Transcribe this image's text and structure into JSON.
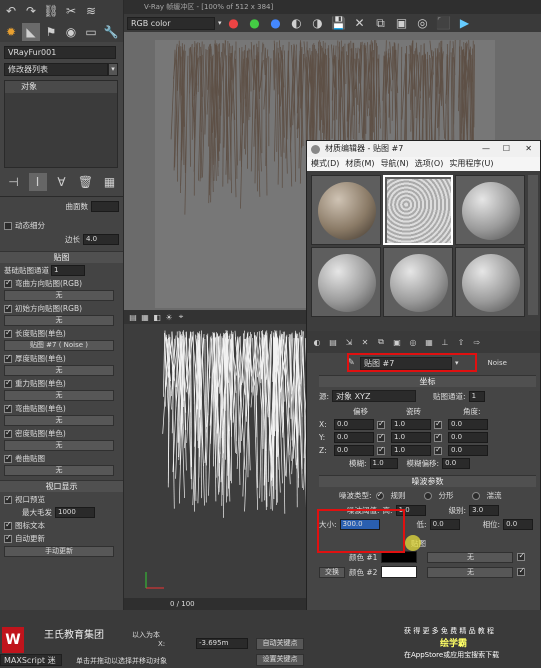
{
  "window": {
    "title": "V-Ray 帧缓冲区 - [100% of 512 x 384]",
    "channel": "RGB color"
  },
  "left_panel": {
    "object_name": "VRayFur001",
    "modifier_list": "修改器列表",
    "stack_item": "对象",
    "bend_count_label": "曲面数",
    "dynamic_subdiv_label": "动态细分",
    "tess_label": "边长",
    "tess_value": "4.0",
    "maps_header": "贴图",
    "base_map_channel_label": "基础贴图通道",
    "base_map_channel_value": "1",
    "map_rows": [
      {
        "label": "弯曲方向贴图(RGB)",
        "value": "无"
      },
      {
        "label": "初始方向贴图(RGB)",
        "value": "无"
      },
      {
        "label": "长度贴图(单色)",
        "value": "贴图 #7 ( Noise )"
      },
      {
        "label": "厚度贴图(单色)",
        "value": "无"
      },
      {
        "label": "重力贴图(单色)",
        "value": "无"
      },
      {
        "label": "弯曲贴图(单色)",
        "value": "无"
      },
      {
        "label": "密度贴图(单色)",
        "value": "无"
      },
      {
        "label": "卷曲贴图",
        "value": "无"
      }
    ],
    "viewport_header": "视口显示",
    "viewport_preview": "视口预览",
    "max_hairs_label": "最大毛发",
    "max_hairs_value": "1000",
    "icon_text": "图标文本",
    "auto_update": "自动更新",
    "manual_update": "手动更新"
  },
  "timeline": {
    "frame": "0 / 100"
  },
  "material_editor": {
    "title": "材质编辑器 - 贴图 #7",
    "menu": [
      "模式(D)",
      "材质(M)",
      "导航(N)",
      "选项(O)",
      "实用程序(U)"
    ],
    "map_name": "贴图 #7",
    "map_type": "Noise",
    "coords_header": "坐标",
    "source_label": "源:",
    "source_value": "对象 XYZ",
    "map_channel_label": "贴图通道:",
    "map_channel_value": "1",
    "offset_label": "偏移",
    "tiling_label": "瓷砖",
    "angle_label": "角度:",
    "axes": [
      "X:",
      "Y:",
      "Z:"
    ],
    "offset_values": [
      "0.0",
      "0.0",
      "0.0"
    ],
    "tiling_values": [
      "1.0",
      "1.0",
      "1.0"
    ],
    "angle_values": [
      "0.0",
      "0.0",
      "0.0"
    ],
    "blur_label": "模糊:",
    "blur_value": "1.0",
    "blur_offset_label": "模糊偏移:",
    "blur_offset_value": "0.0",
    "noise_header": "噪波参数",
    "noise_type_label": "噪波类型:",
    "noise_types": [
      "规则",
      "分形",
      "湍流"
    ],
    "threshold_label": "噪波阈值:",
    "high_label": "高:",
    "high_value": "1.0",
    "levels_label": "级别:",
    "levels_value": "3.0",
    "size_label": "大小:",
    "size_value": "300.0",
    "low_label": "低:",
    "low_value": "0.0",
    "phase_label": "相位:",
    "phase_value": "0.0",
    "swap_label": "交换",
    "color1_label": "颜色 #1",
    "color2_label": "颜色 #2",
    "maps_label": "贴图",
    "none_label": "无"
  },
  "status_bar": {
    "maxscript": "MAXScript 迷",
    "x_label": "X:",
    "z_value": "-3.695m",
    "auto_key": "自动关键点",
    "set_key": "设置关键点",
    "hint": "单击并拖动以选择并移动对象",
    "selected": "以入为本"
  },
  "watermarks": {
    "brand": "王氏教育集团",
    "right_line1": "获 得 更 多 免 费 精 品 教 程",
    "right_brand": "绘学霸",
    "right_line2": "在AppStore或应用宝搜索下载"
  },
  "colors": {
    "highlight_red": "#e01010",
    "brand_red": "#c0141c"
  }
}
